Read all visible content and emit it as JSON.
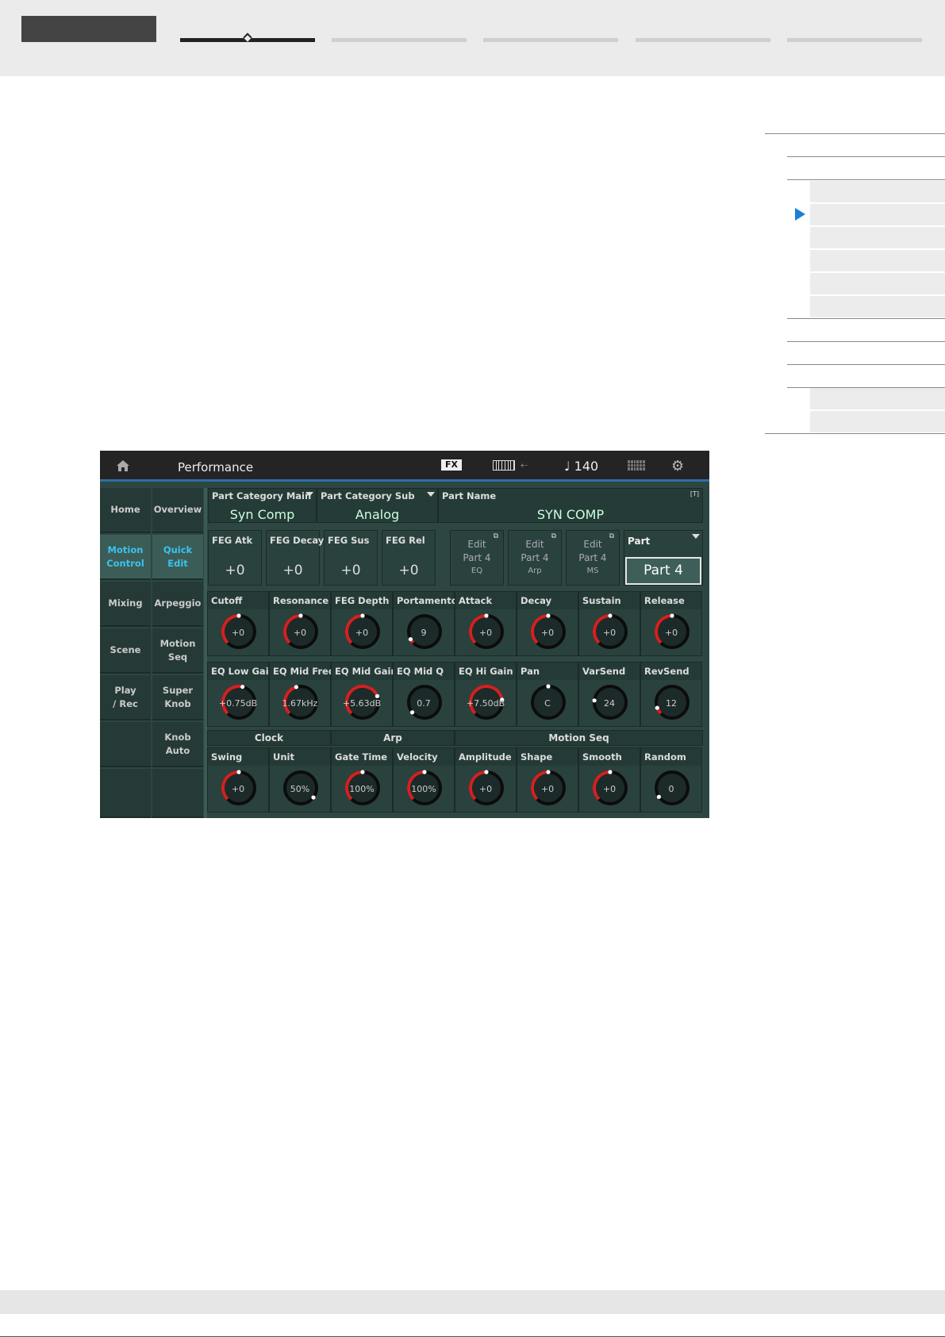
{
  "screen": {
    "title": "Performance",
    "fx_label": "FX",
    "tempo": "♩ 140",
    "usb_glyph": "⇠",
    "gear_glyph": "⚙"
  },
  "menu": {
    "col1": [
      "Home",
      "Motion\nControl",
      "Mixing",
      "Scene",
      "Play\n/ Rec",
      ""
    ],
    "col2": [
      "Overview",
      "Quick\nEdit",
      "Arpeggio",
      "Motion\nSeq",
      "Super\nKnob",
      "Knob\nAuto"
    ]
  },
  "header": {
    "cat_main_label": "Part Category Main",
    "cat_main_value": "Syn Comp",
    "cat_sub_label": "Part Category Sub",
    "cat_sub_value": "Analog",
    "name_label": "Part Name",
    "name_value": "SYN COMP",
    "name_tag": "[T]"
  },
  "feg": [
    {
      "label": "FEG Atk",
      "value": "+0"
    },
    {
      "label": "FEG Decay",
      "value": "+0"
    },
    {
      "label": "FEG Sus",
      "value": "+0"
    },
    {
      "label": "FEG Rel",
      "value": "+0"
    }
  ],
  "edit_buttons": [
    {
      "l1": "Edit",
      "l2": "Part 4",
      "l3": "EQ"
    },
    {
      "l1": "Edit",
      "l2": "Part 4",
      "l3": "Arp"
    },
    {
      "l1": "Edit",
      "l2": "Part 4",
      "l3": "MS"
    }
  ],
  "part": {
    "label": "Part",
    "value": "Part 4"
  },
  "knob_row1": [
    {
      "label": "Cutoff",
      "value": "+0",
      "pos": 0.5,
      "red": true
    },
    {
      "label": "Resonance",
      "value": "+0",
      "pos": 0.5,
      "red": true
    },
    {
      "label": "FEG Depth",
      "value": "+0",
      "pos": 0.5,
      "red": true
    },
    {
      "label": "Portamento",
      "value": "9",
      "pos": 0.06,
      "red": true
    },
    {
      "label": "Attack",
      "value": "+0",
      "pos": 0.5,
      "red": true
    },
    {
      "label": "Decay",
      "value": "+0",
      "pos": 0.5,
      "red": true
    },
    {
      "label": "Sustain",
      "value": "+0",
      "pos": 0.5,
      "red": true
    },
    {
      "label": "Release",
      "value": "+0",
      "pos": 0.5,
      "red": true
    }
  ],
  "knob_row2": [
    {
      "label": "EQ Low Gain",
      "value": "+0.75dB",
      "pos": 0.55,
      "red": true
    },
    {
      "label": "EQ Mid Freq",
      "value": "1.67kHz",
      "pos": 0.44,
      "red": true
    },
    {
      "label": "EQ Mid Gain",
      "value": "+5.63dB",
      "pos": 0.75,
      "red": true
    },
    {
      "label": "EQ Mid Q",
      "value": "0.7",
      "pos": 0.02,
      "red": false
    },
    {
      "label": "EQ Hi Gain",
      "value": "+7.50dB",
      "pos": 0.8,
      "red": true
    },
    {
      "label": "Pan",
      "value": "C",
      "pos": 0.5,
      "red": false
    },
    {
      "label": "VarSend",
      "value": "24",
      "pos": 0.19,
      "red": false
    },
    {
      "label": "RevSend",
      "value": "12",
      "pos": 0.09,
      "red": true
    }
  ],
  "groups": [
    {
      "label": "Clock"
    },
    {
      "label": "Arp"
    },
    {
      "label": "Motion Seq"
    }
  ],
  "knob_row3": [
    {
      "label": "Swing",
      "value": "+0",
      "pos": 0.5,
      "red": true
    },
    {
      "label": "Unit",
      "value": "50%",
      "pos": 0.97,
      "red": false
    },
    {
      "label": "Gate Time",
      "value": "100%",
      "pos": 0.5,
      "red": true
    },
    {
      "label": "Velocity",
      "value": "100%",
      "pos": 0.5,
      "red": true
    },
    {
      "label": "Amplitude",
      "value": "+0",
      "pos": 0.5,
      "red": true
    },
    {
      "label": "Shape",
      "value": "+0",
      "pos": 0.5,
      "red": true
    },
    {
      "label": "Smooth",
      "value": "+0",
      "pos": 0.5,
      "red": true
    },
    {
      "label": "Random",
      "value": "0",
      "pos": 0.04,
      "red": false
    }
  ],
  "colors": {
    "accent_blue": "#1a7fd6",
    "knob_red": "#d52020",
    "screen_bg": "#2d4642",
    "selected_menu_text": "#39c4ef"
  }
}
